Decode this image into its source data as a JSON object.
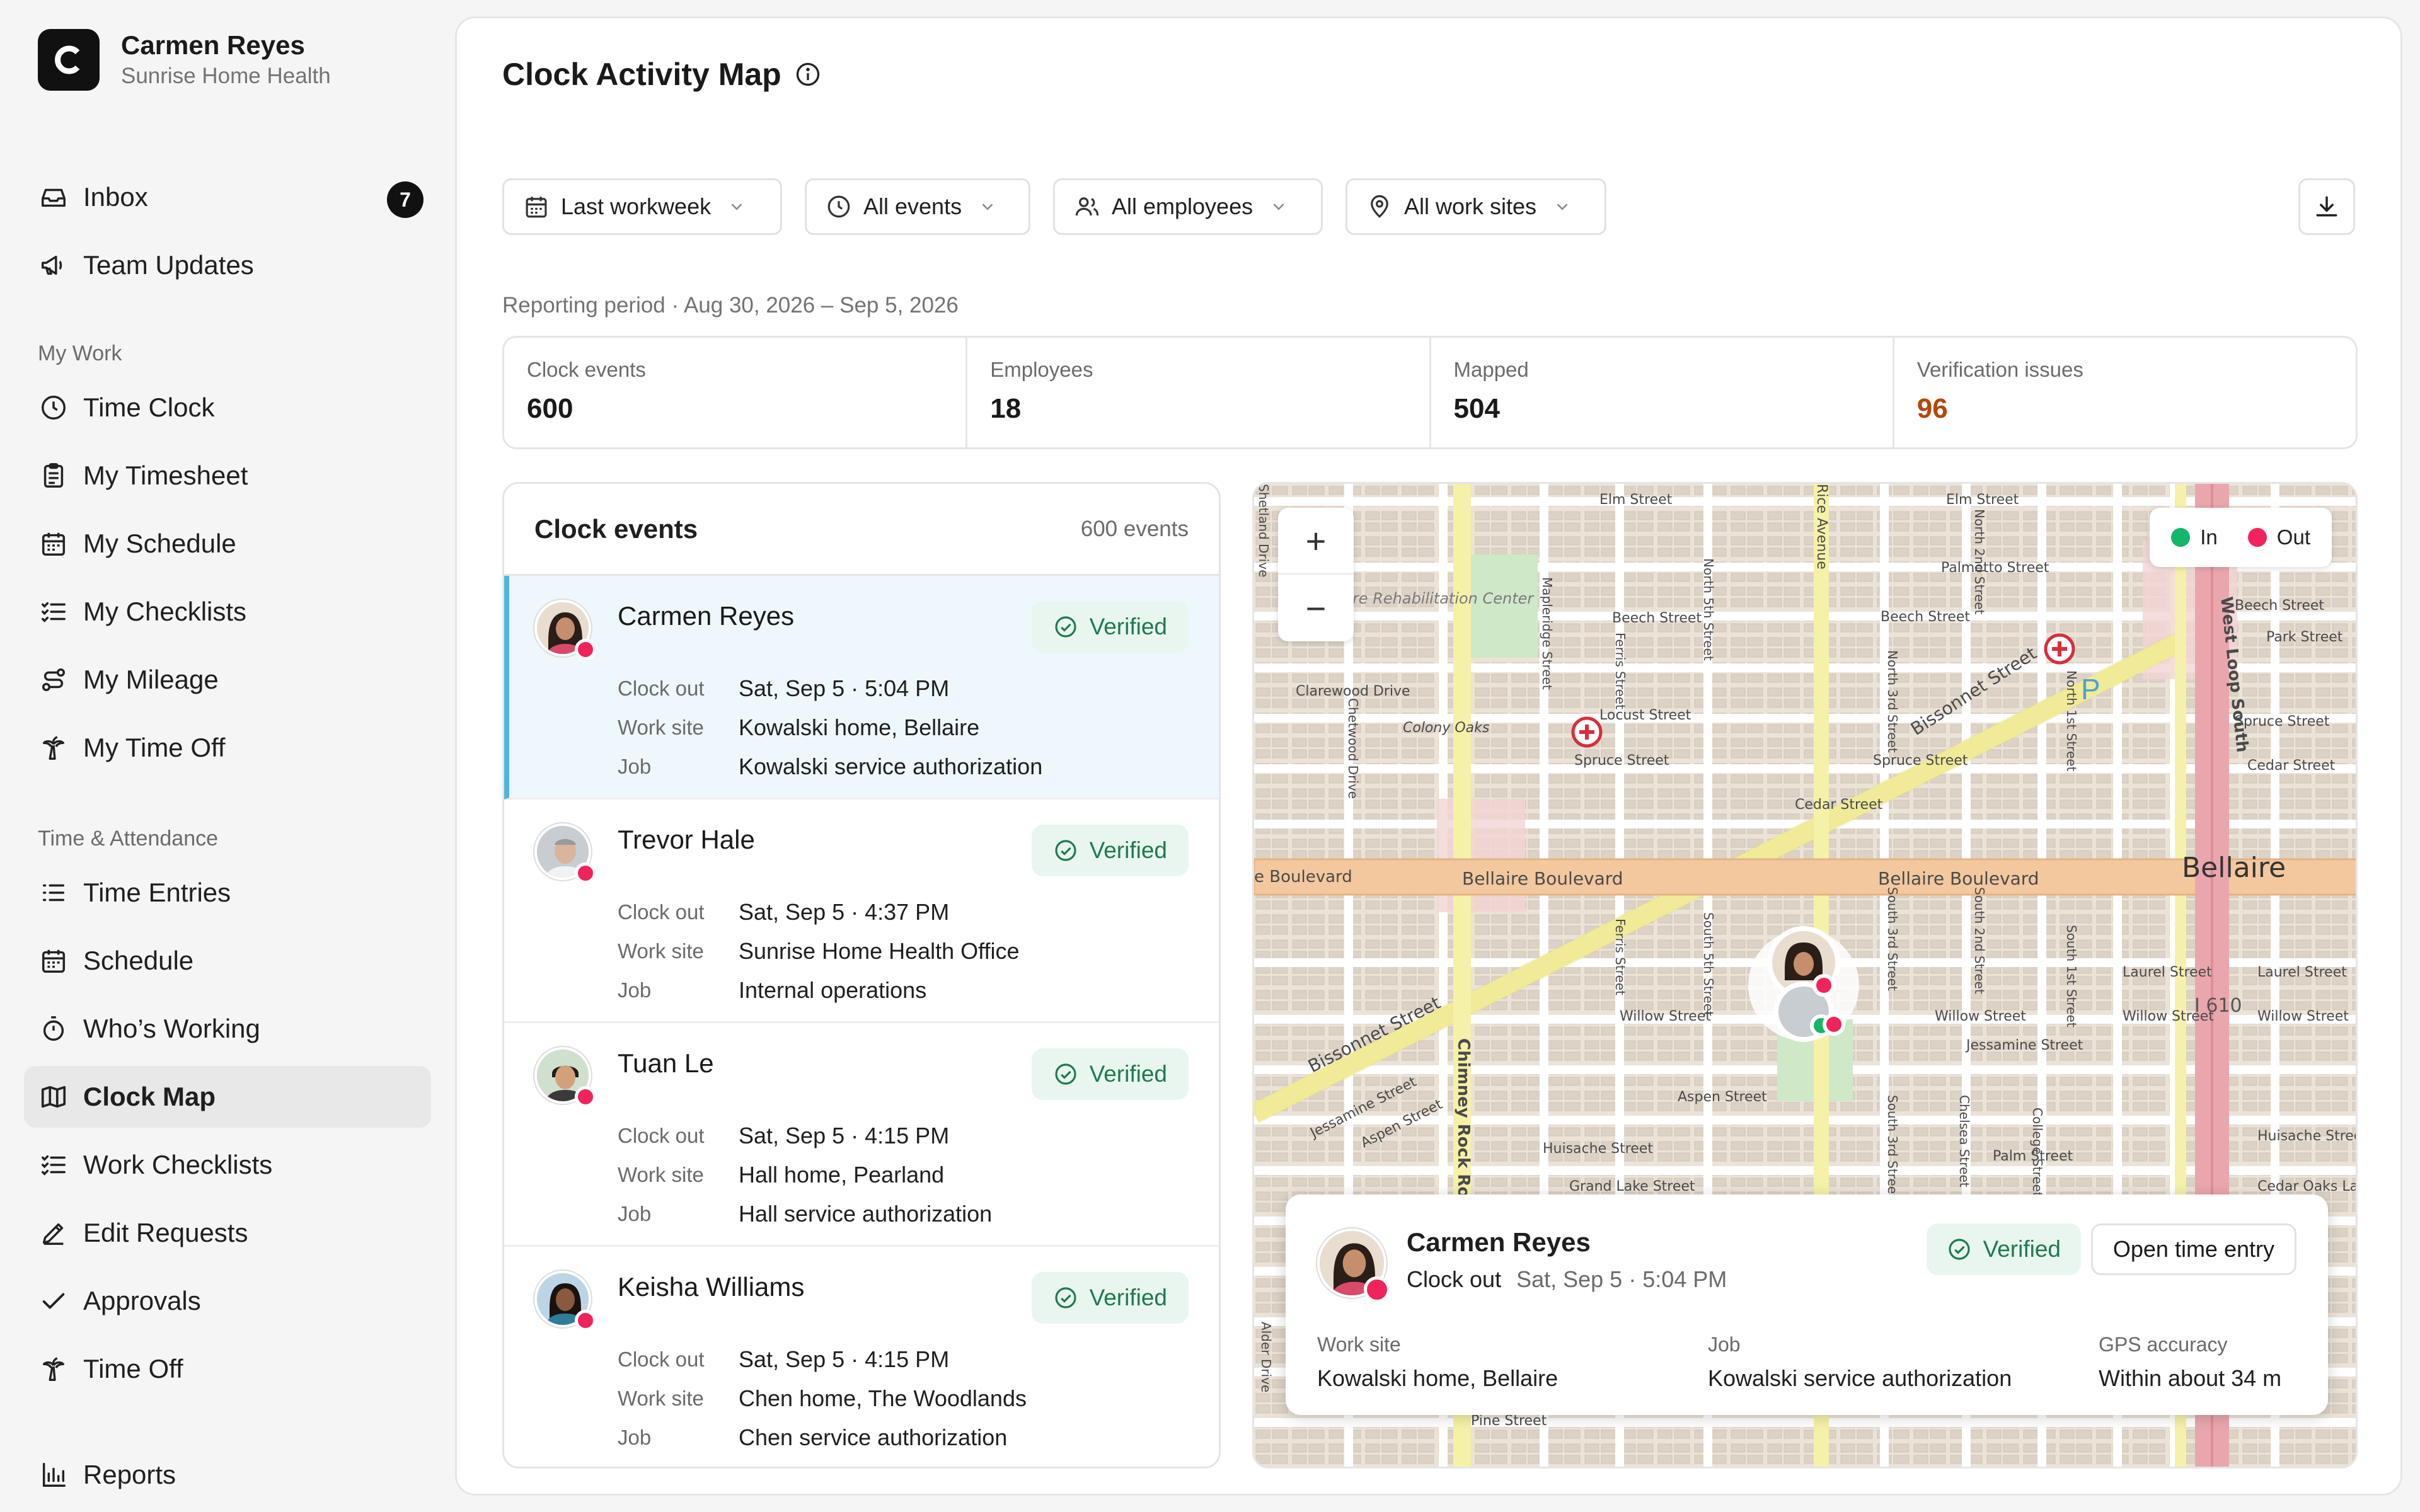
{
  "brand": {
    "name": "Carmen Reyes",
    "org": "Sunrise Home Health"
  },
  "sidebar": {
    "top_items": [
      {
        "label": "Inbox",
        "icon": "inbox-icon",
        "badge": "7"
      },
      {
        "label": "Team Updates",
        "icon": "megaphone-icon"
      }
    ],
    "my_work_title": "My Work",
    "my_work": [
      {
        "label": "Time Clock",
        "icon": "clock-icon"
      },
      {
        "label": "My Timesheet",
        "icon": "clipboard-icon"
      },
      {
        "label": "My Schedule",
        "icon": "calendar-icon"
      },
      {
        "label": "My Checklists",
        "icon": "checklist-icon"
      },
      {
        "label": "My Mileage",
        "icon": "route-icon"
      },
      {
        "label": "My Time Off",
        "icon": "palm-tree-icon"
      }
    ],
    "ta_title": "Time & Attendance",
    "ta": [
      {
        "label": "Time Entries",
        "icon": "list-icon"
      },
      {
        "label": "Schedule",
        "icon": "calendar-icon"
      },
      {
        "label": "Who’s Working",
        "icon": "stopwatch-icon"
      },
      {
        "label": "Clock Map",
        "icon": "map-icon",
        "active": true
      },
      {
        "label": "Work Checklists",
        "icon": "checklist-icon"
      },
      {
        "label": "Edit Requests",
        "icon": "pencil-icon"
      },
      {
        "label": "Approvals",
        "icon": "check-icon"
      },
      {
        "label": "Time Off",
        "icon": "palm-tree-icon"
      }
    ],
    "reports": {
      "label": "Reports",
      "icon": "bar-chart-icon"
    }
  },
  "page": {
    "title": "Clock Activity Map",
    "filters": {
      "period": "Last workweek",
      "events": "All events",
      "employees": "All employees",
      "sites": "All work sites"
    },
    "reporting_period": "Reporting period · Aug 30, 2026 – Sep 5, 2026"
  },
  "stats": [
    {
      "label": "Clock events",
      "value": "600"
    },
    {
      "label": "Employees",
      "value": "18"
    },
    {
      "label": "Mapped",
      "value": "504"
    },
    {
      "label": "Verification issues",
      "value": "96",
      "warn": true
    }
  ],
  "events_panel": {
    "title": "Clock events",
    "count": "600 events",
    "labels": {
      "type": "Clock out",
      "site": "Work site",
      "job": "Job"
    },
    "items": [
      {
        "name": "Carmen Reyes",
        "status": "Verified",
        "event_label": "Clock out",
        "time": "Sat, Sep 5 · 5:04 PM",
        "site": "Kowalski home, Bellaire",
        "job": "Kowalski service authorization",
        "dot": "#f0245a"
      },
      {
        "name": "Trevor Hale",
        "status": "Verified",
        "event_label": "Clock out",
        "time": "Sat, Sep 5 · 4:37 PM",
        "site": "Sunrise Home Health Office",
        "job": "Internal operations",
        "dot": "#f0245a"
      },
      {
        "name": "Tuan Le",
        "status": "Verified",
        "event_label": "Clock out",
        "time": "Sat, Sep 5 · 4:15 PM",
        "site": "Hall home, Pearland",
        "job": "Hall service authorization",
        "dot": "#f0245a"
      },
      {
        "name": "Keisha Williams",
        "status": "Verified",
        "event_label": "Clock out",
        "time": "Sat, Sep 5 · 4:15 PM",
        "site": "Chen home, The Woodlands",
        "job": "Chen service authorization",
        "dot": "#f0245a"
      }
    ],
    "key_site": "Work site",
    "key_job": "Job"
  },
  "map": {
    "legend": {
      "in": "In",
      "out": "Out",
      "in_color": "#12b76a",
      "out_color": "#f0245a"
    },
    "zoom_in": "+",
    "zoom_out": "−",
    "streets": {
      "elm": "Elm Street",
      "elm2": "Elm Street",
      "bellaire_blvd": "Bellaire Boulevard",
      "bellaire_blvd2": "Bellaire Boulevard",
      "bellaire": "Bellaire",
      "blvd_left": "e Boulevard",
      "bissonnet": "Bissonnet Street",
      "bissonnet2": "Bissonnet Street",
      "west_loop": "West Loop South",
      "chimney": "Chimney Rock Road",
      "i610": "I 610",
      "jessamine": "Jessamine Street",
      "willow": "Willow Street",
      "willow2": "Willow Street",
      "willow3": "Willow Street",
      "willow4": "Willow Street",
      "laurel": "Laurel Street",
      "laurel2": "Laurel Street",
      "spruce": "Spruce Street",
      "spruce2": "Spruce Street",
      "spruce3": "Spruce Street",
      "locust": "Locust Street",
      "cedar": "Cedar Street",
      "cedar2": "Cedar Street",
      "beech": "Beech Street",
      "beech2": "Beech Street",
      "beech3": "Beech Street",
      "park": "Park Street",
      "palmetto": "Palmetto Street",
      "aspen": "Aspen Street",
      "aspen2": "Aspen Street",
      "huisache": "Huisache Street",
      "huisache2": "Huisache Street",
      "grand_lake": "Grand Lake Street",
      "cedar_oaks": "Cedar Oaks Lan",
      "pine": "Pine Street",
      "palm": "Palm Street",
      "clarewood": "Clarewood Drive",
      "colony_oaks": "Colony Oaks",
      "rehab": "Bellaire Rehabilitation Center",
      "rice_ave": "Rice Avenue",
      "n5th": "North 5th Street",
      "n3rd": "North 3rd Street",
      "n2nd": "North 2nd Street",
      "n1st": "North 1st Street",
      "s5th": "South 5th Street",
      "s3rd": "South 3rd Street",
      "s2nd": "South 2nd Street",
      "s1st": "South 1st Street",
      "mapleridge": "Mapleridge Street",
      "ferris": "Ferris Street",
      "chetwood": "Chetwood Drive",
      "shetland": "Shetland Drive",
      "alder": "Alder Drive",
      "chelsea": "Chelsea Street",
      "college": "College Street",
      "jessamine2": "Jessamine Street"
    },
    "card": {
      "name": "Carmen Reyes",
      "event": "Clock out",
      "time": "Sat, Sep 5 · 5:04 PM",
      "status": "Verified",
      "open_button": "Open time entry",
      "site_label": "Work site",
      "site": "Kowalski home, Bellaire",
      "job_label": "Job",
      "job": "Kowalski service authorization",
      "gps_label": "GPS accuracy",
      "gps": "Within about 34 m"
    }
  }
}
